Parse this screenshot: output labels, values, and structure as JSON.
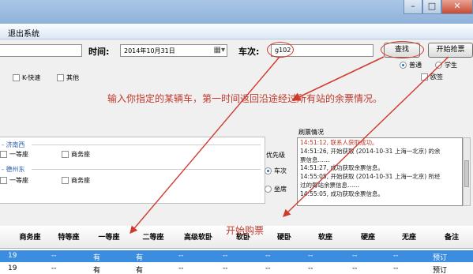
{
  "menu": {
    "exit": "退出系统"
  },
  "toolbar": {
    "time_label": "时间:",
    "date_value": "2014年10月31日",
    "train_label": "车次:",
    "train_value": "g102",
    "search_label": "查找",
    "start_label": "开始抢票"
  },
  "options": {
    "k_express": "K-快速",
    "other": "其他",
    "normal": "普通",
    "student": "学生",
    "pickup": "欧签"
  },
  "annotation": {
    "note": "输入你指定的某辆车，第一时间返回沿途经过所有站的余票情况。",
    "start": "开始购票"
  },
  "seat_panel": {
    "station1": "济南西",
    "station2": "德州东",
    "first_class": "一等座",
    "business": "商务座"
  },
  "priority": {
    "label": "优先级",
    "train": "车次",
    "seat": "坐席"
  },
  "log": {
    "title": "刷票情况",
    "lines": [
      "14:51:12, 联系人获取成功。",
      "14:51:26, 开始获取  (2014-10-31 上海一北京) 的余",
      "票信息……",
      "14:51:27, 成功获取余票信息。",
      "14:55:05, 开始获取  (2014-10-31 上海一北京) 所经",
      "过的每站余票信息……",
      "14:55:05, 成功获取余票信息。"
    ]
  },
  "grid": {
    "headers": [
      "商务座",
      "特等座",
      "一等座",
      "二等座",
      "高级软卧",
      "软卧",
      "硬卧",
      "软座",
      "硬座",
      "无座",
      "备注"
    ],
    "rows": [
      [
        "19",
        "--",
        "有",
        "有",
        "--",
        "--",
        "--",
        "--",
        "--",
        "--",
        "预订"
      ],
      [
        "19",
        "--",
        "有",
        "有",
        "--",
        "--",
        "--",
        "--",
        "--",
        "--",
        "预订"
      ]
    ]
  },
  "colors": {
    "accent_red": "#c0392b",
    "selection": "#3b8de0"
  }
}
